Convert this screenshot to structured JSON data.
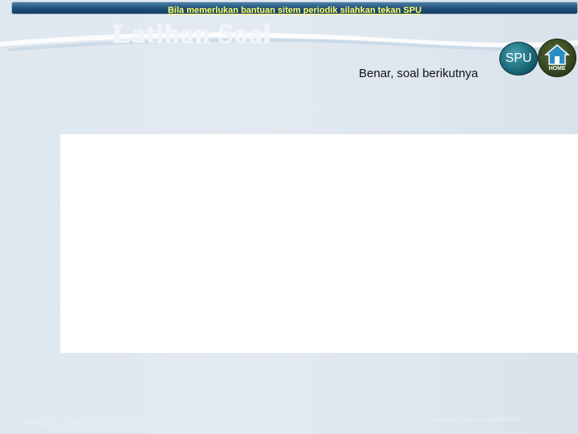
{
  "banner": {
    "text": "Bila memerlukan bantuan sitem periodik silahkan tekan SPU"
  },
  "header": {
    "title": "Latihan Soal"
  },
  "feedback": {
    "text": "Benar,  soal berikutnya"
  },
  "nav": {
    "spu_label": "SPU",
    "home_label": "HOME"
  },
  "footer": {
    "left_text": "KIMIA SMA KELAS X",
    "right_text": "Ihsan Hadi Darsono 085335655592"
  },
  "colors": {
    "banner_text": "#ffff66",
    "banner_bg": "#1e4f78",
    "spu_button": "#1a6a7a",
    "home_button": "#2d3e1c"
  }
}
